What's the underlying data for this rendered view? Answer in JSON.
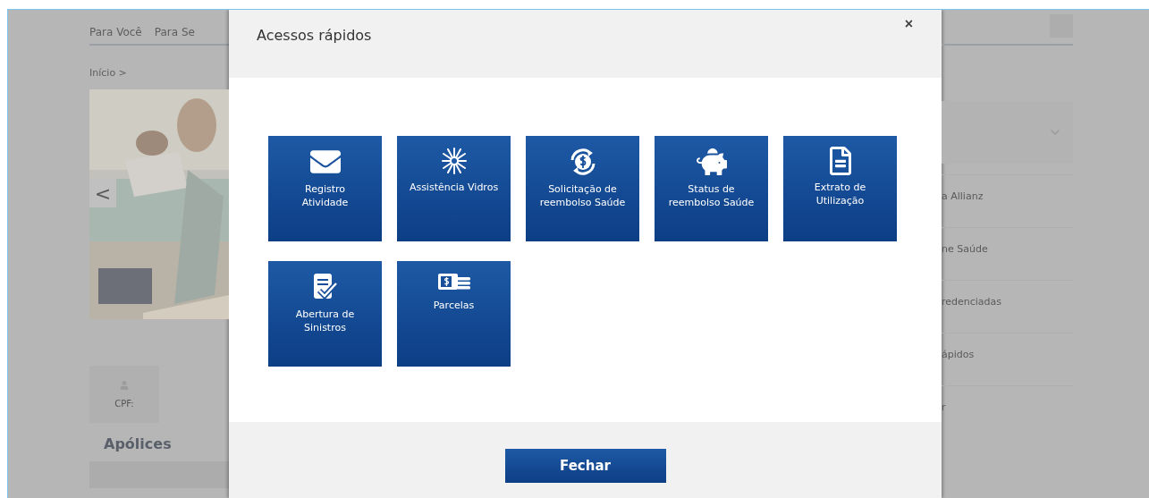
{
  "background_page": {
    "nav": [
      "Para Você",
      "Para Se"
    ],
    "breadcrumb": "Início >",
    "carousel_arrow": "<",
    "profile_label": "CPF:",
    "section_title": "Apólices",
    "menu_items": [
      "a Allianz",
      "ne Saúde",
      "redenciadas",
      "ápidos",
      "r"
    ]
  },
  "dialog": {
    "title": "Acessos rápidos",
    "close": "×",
    "tiles": [
      {
        "label": "Registro Atividade"
      },
      {
        "label": "Assistência Vidros"
      },
      {
        "label": "Solicitação de reembolso Saúde"
      },
      {
        "label": "Status de reembolso Saúde"
      },
      {
        "label": "Extrato de Utilização"
      },
      {
        "label": "Abertura de Sinistros"
      },
      {
        "label": "Parcelas"
      }
    ],
    "button": "Fechar"
  }
}
